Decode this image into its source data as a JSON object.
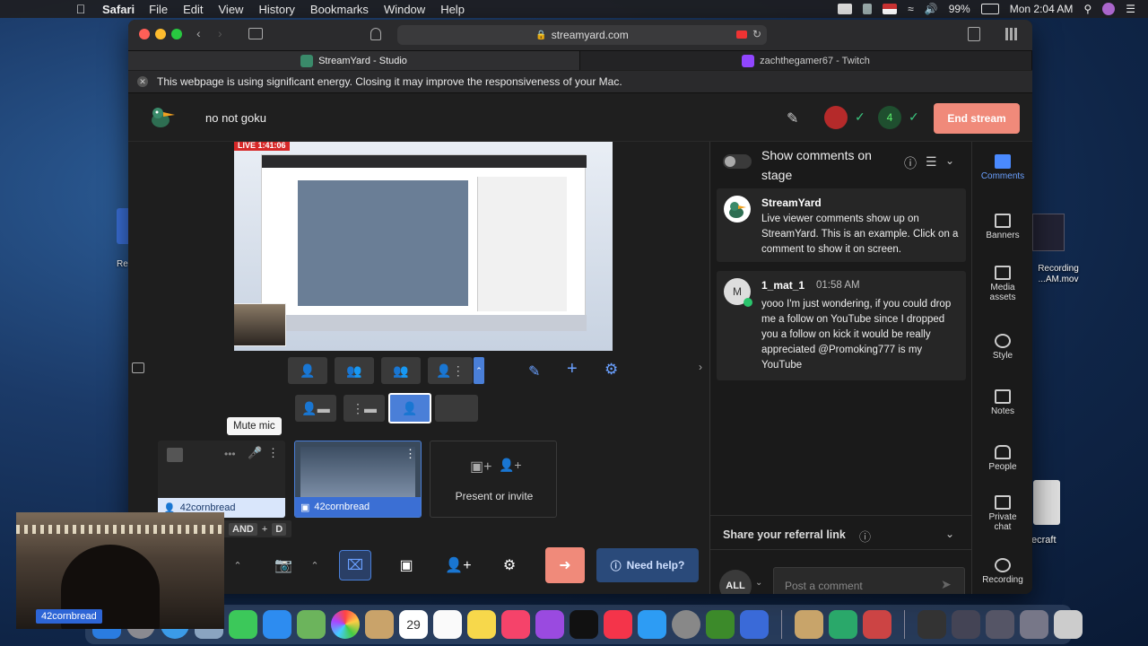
{
  "menubar": {
    "app": "Safari",
    "items": [
      "File",
      "Edit",
      "View",
      "History",
      "Bookmarks",
      "Window",
      "Help"
    ],
    "battery": "99%",
    "clock": "Mon 2:04 AM"
  },
  "browser": {
    "url": "streamyard.com",
    "tabs": [
      {
        "label": "StreamYard - Studio"
      },
      {
        "label": "zachthegamer67 - Twitch"
      }
    ],
    "energy_warning": "This webpage is using significant energy. Closing it may improve the responsiveness of your Mac."
  },
  "studio": {
    "broadcast_title": "no not goku",
    "end_stream_label": "End stream",
    "stage_live_tag": "LIVE 1:41:06",
    "tooltip": "Mute mic",
    "participants": [
      {
        "name": "42cornbread"
      },
      {
        "name": "42cornbread"
      }
    ],
    "present_label": "Present or invite",
    "shortcut": {
      "key1": "AND",
      "plus": "+",
      "key2": "D"
    },
    "need_help_label": "Need help?"
  },
  "comments_panel": {
    "toggle_label": "Show comments on stage",
    "comments": [
      {
        "author": "StreamYard",
        "time": "",
        "text": "Live viewer comments show up on StreamYard. This is an example. Click on a comment to show it on screen."
      },
      {
        "author": "1_mat_1",
        "time": "01:58 AM",
        "avatar_letter": "M",
        "text": "yooo I'm just wondering, if you could drop me a follow on YouTube since I dropped you a follow on kick it would be really appreciated @Promoking777 is my YouTube"
      }
    ],
    "referral_label": "Share your referral link",
    "audience_label": "ALL",
    "post_placeholder": "Post a comment"
  },
  "rail": {
    "items": [
      {
        "label": "Comments",
        "icon": "comments-icon",
        "active": true
      },
      {
        "label": "Banners",
        "icon": "banners-icon",
        "active": false
      },
      {
        "label": "Media assets",
        "icon": "media-assets-icon",
        "active": false
      },
      {
        "label": "Style",
        "icon": "palette-icon",
        "active": false
      },
      {
        "label": "Notes",
        "icon": "notes-icon",
        "active": false
      },
      {
        "label": "People",
        "icon": "people-icon",
        "active": false
      },
      {
        "label": "Private chat",
        "icon": "private-chat-icon",
        "active": false
      },
      {
        "label": "Recording",
        "icon": "recording-icon",
        "active": false
      }
    ]
  },
  "desktop": {
    "file1": "Recording ...AM.mov",
    "file2": "ecraft",
    "file3": "Re",
    "webcam_name": "42cornbread",
    "dock_calendar_day": "29"
  }
}
